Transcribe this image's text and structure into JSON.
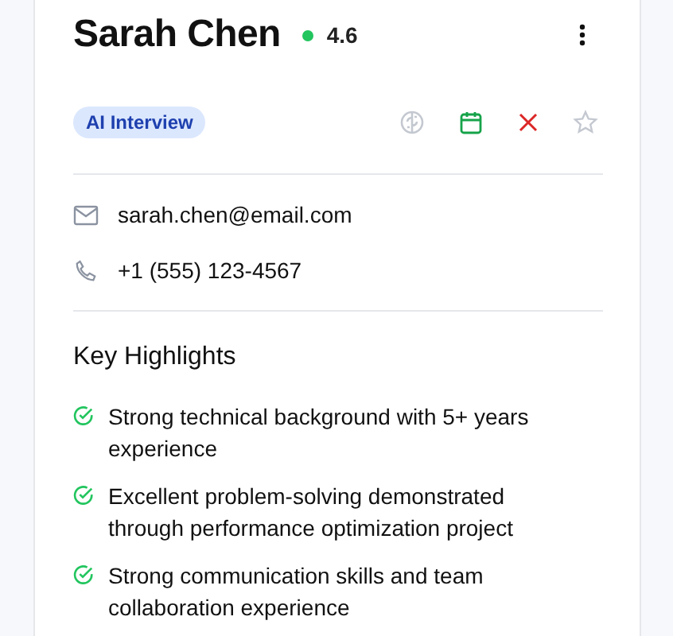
{
  "candidate": {
    "name": "Sarah Chen",
    "status": {
      "color": "#22c55e"
    },
    "rating": "4.6"
  },
  "badge": "AI Interview",
  "contact": [
    {
      "kind": "email",
      "text": "sarah.chen@email.com"
    },
    {
      "kind": "phone",
      "text": "+1 (555) 123-4567"
    }
  ],
  "highlights": {
    "title": "Key Highlights",
    "items": [
      "Strong technical background with 5+ years experience",
      "Excellent problem-solving demonstrated through performance optimization project",
      "Strong communication skills and team collaboration experience"
    ]
  }
}
